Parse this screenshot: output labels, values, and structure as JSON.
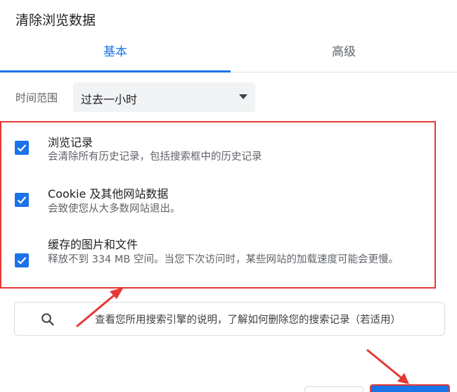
{
  "dialog": {
    "title": "清除浏览数据"
  },
  "tabs": [
    {
      "label": "基本",
      "active": true
    },
    {
      "label": "高级",
      "active": false
    }
  ],
  "time_range": {
    "label": "时间范围",
    "selected": "过去一小时"
  },
  "options": [
    {
      "title": "浏览记录",
      "description": "会清除所有历史记录，包括搜索框中的历史记录",
      "checked": true
    },
    {
      "title": "Cookie 及其他网站数据",
      "description": "会致使您从大多数网站退出。",
      "checked": true
    },
    {
      "title": "缓存的图片和文件",
      "description": "释放不到 334 MB 空间。当您下次访问时，某些网站的加载速度可能会更慢。",
      "checked": true
    }
  ],
  "search_info": {
    "icon": "search-icon",
    "text": "查看您所用搜索引擎的说明，了解如何删除您的搜索记录（若适用）"
  },
  "colors": {
    "accent": "#1a73e8",
    "annotation": "#e53935"
  }
}
